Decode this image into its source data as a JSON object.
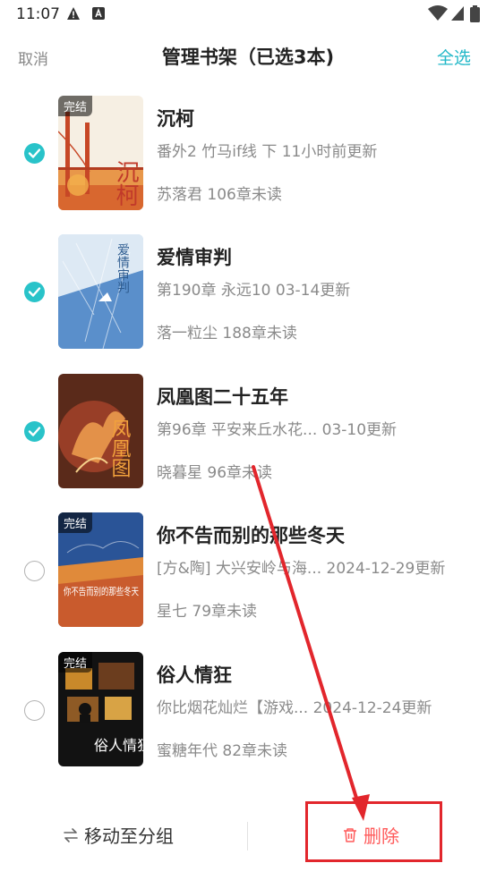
{
  "status": {
    "time": "11:07"
  },
  "header": {
    "cancel": "取消",
    "title": "管理书架（已选3本)",
    "select_all": "全选"
  },
  "books": [
    {
      "title": "沉柯",
      "update": "番外2 竹马if线 下 11小时前更新",
      "meta": "苏落君  106章未读",
      "badge": "完结",
      "checked": true
    },
    {
      "title": "爱情审判",
      "update": "第190章 永远10 03-14更新",
      "meta": "落一粒尘  188章未读",
      "badge": "",
      "checked": true
    },
    {
      "title": "凤凰图二十五年",
      "update": "第96章 平安来丘水花... 03-10更新",
      "meta": "晓暮星  96章未读",
      "badge": "",
      "checked": true
    },
    {
      "title": "你不告而别的那些冬天",
      "update": "[方&陶] 大兴安岭与海... 2024-12-29更新",
      "meta": "星七  79章未读",
      "badge": "完结",
      "checked": false
    },
    {
      "title": "俗人情狂",
      "update": "你比烟花灿烂【游戏... 2024-12-24更新",
      "meta": "蜜糖年代  82章未读",
      "badge": "完结",
      "checked": false
    }
  ],
  "covers": {
    "c1": "沉柯",
    "c2": "爱情审判",
    "c3": "凤凰图",
    "c4": "你不告而别的那些冬天",
    "c5": "俗人情狂"
  },
  "bottom": {
    "move": "移动至分组",
    "delete": "删除"
  },
  "colors": {
    "accent": "#29c3c9",
    "delete": "#ff5a5a",
    "annotation": "#e2262c"
  }
}
